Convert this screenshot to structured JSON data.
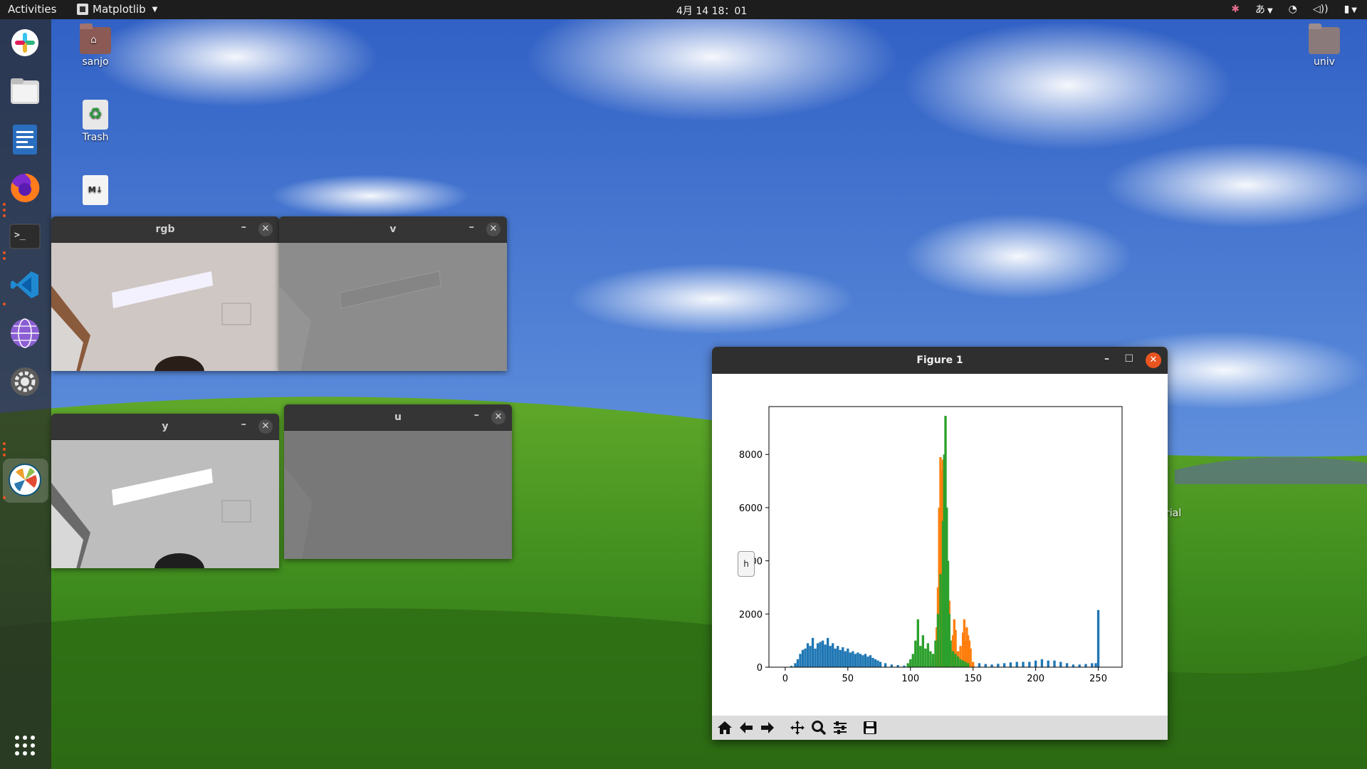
{
  "topbar": {
    "activities": "Activities",
    "app_name": "Matplotlib",
    "clock": "4月 14 18：01",
    "input_method": "あ"
  },
  "desktop": {
    "icons": [
      {
        "label": "sanjo",
        "icon": "home-folder-icon"
      },
      {
        "label": "Trash",
        "icon": "trash-icon"
      },
      {
        "label": "",
        "icon": "markdown-file-icon"
      },
      {
        "label": "univ",
        "icon": "folder-icon"
      }
    ],
    "partial_text": "rial"
  },
  "dock": {
    "items": [
      "slack-icon",
      "files-icon",
      "writer-icon",
      "firefox-icon",
      "terminal-icon",
      "vscode-icon",
      "browser-icon",
      "settings-icon",
      "matplotlib-icon",
      "show-apps-icon"
    ]
  },
  "windows": {
    "rgb": {
      "title": "rgb"
    },
    "v": {
      "title": "v"
    },
    "y": {
      "title": "y"
    },
    "u": {
      "title": "u"
    },
    "figure": {
      "title": "Figure 1",
      "tooltip": "h"
    }
  },
  "colors": {
    "accent_close": "#e95420",
    "series_blue": "#1f77b4",
    "series_orange": "#ff7f0e",
    "series_green": "#2ca02c"
  },
  "toolbar": [
    "home-icon",
    "back-arrow-icon",
    "forward-arrow-icon",
    "pan-icon",
    "zoom-icon",
    "configure-subplots-icon",
    "save-icon"
  ],
  "chart_data": {
    "type": "bar",
    "title": "",
    "xlabel": "",
    "ylabel": "",
    "xlim": [
      -13,
      269
    ],
    "ylim": [
      0,
      9800
    ],
    "x_ticks": [
      0,
      50,
      100,
      150,
      200,
      250
    ],
    "y_ticks": [
      0,
      2000,
      4000,
      6000,
      8000
    ],
    "grid": false,
    "series": [
      {
        "color": "#1f77b4",
        "x": [
          5,
          8,
          10,
          12,
          14,
          16,
          18,
          20,
          22,
          24,
          26,
          28,
          30,
          32,
          34,
          36,
          38,
          40,
          42,
          44,
          46,
          48,
          50,
          52,
          54,
          56,
          58,
          60,
          62,
          64,
          66,
          68,
          70,
          72,
          74,
          76,
          80,
          85,
          90,
          95,
          100,
          105,
          110,
          115,
          120,
          125,
          130,
          135,
          140,
          145,
          150,
          155,
          160,
          165,
          170,
          175,
          180,
          185,
          190,
          195,
          200,
          205,
          210,
          215,
          220,
          225,
          230,
          235,
          240,
          245,
          248,
          250
        ],
        "values": [
          50,
          150,
          300,
          500,
          650,
          700,
          900,
          800,
          1100,
          700,
          900,
          950,
          1000,
          850,
          1100,
          800,
          900,
          700,
          800,
          650,
          750,
          600,
          700,
          550,
          600,
          500,
          550,
          500,
          450,
          500,
          400,
          450,
          350,
          300,
          250,
          200,
          150,
          100,
          80,
          60,
          50,
          40,
          30,
          30,
          30,
          30,
          30,
          30,
          50,
          80,
          100,
          150,
          120,
          100,
          130,
          150,
          180,
          200,
          200,
          200,
          250,
          300,
          250,
          250,
          200,
          150,
          100,
          100,
          120,
          150,
          150,
          2150
        ]
      },
      {
        "color": "#ff7f0e",
        "x": [
          118,
          120,
          121,
          122,
          123,
          124,
          125,
          126,
          127,
          128,
          129,
          130,
          131,
          132,
          133,
          134,
          135,
          136,
          138,
          140,
          142,
          143,
          144,
          145,
          146,
          147,
          148,
          150
        ],
        "values": [
          200,
          500,
          1500,
          3000,
          6000,
          7900,
          7400,
          7800,
          7300,
          5000,
          3000,
          1500,
          2500,
          1000,
          600,
          1200,
          1800,
          1400,
          600,
          800,
          1300,
          1800,
          1000,
          1500,
          1200,
          1000,
          700,
          200
        ]
      },
      {
        "color": "#2ca02c",
        "x": [
          98,
          100,
          102,
          104,
          106,
          108,
          110,
          112,
          114,
          116,
          118,
          120,
          122,
          124,
          126,
          127,
          128,
          129,
          130,
          131,
          132,
          134,
          136,
          138,
          140,
          142,
          144,
          146
        ],
        "values": [
          150,
          300,
          500,
          1000,
          1800,
          800,
          1200,
          700,
          900,
          600,
          500,
          1000,
          2000,
          3500,
          5500,
          8000,
          9450,
          6000,
          4000,
          2000,
          1000,
          600,
          500,
          400,
          300,
          250,
          200,
          150
        ]
      }
    ]
  }
}
